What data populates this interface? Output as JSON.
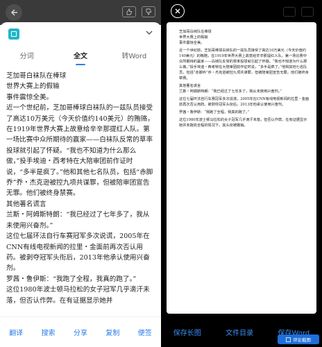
{
  "left": {
    "tabs": [
      {
        "label": "分词"
      },
      {
        "label": "全文"
      },
      {
        "label": "转Word"
      }
    ],
    "article": [
      "芝加哥白袜队在棒球",
      "世界大赛上的假输",
      "事件震惊全美。",
      "近一个世纪前，芝加哥棒球白袜队的一兹队员接受了高达10万美元（今天价值约140美元）的贿赂，在1919年世界大赛上故意给辛辛那提红人队。第一场比赛中众所期待的赢家——白袜队反常的草率投球就引起了怀疑。“我也不知道为什么那么做，”投手埃迪・西考特在大陪审团前作证时说，“多半是疯了。”他和其他七名队员，包括“赤脚乔”乔・杰克逊被控九项共谋罪，但被陪审团宣告无罪。他们被终身禁赛。",
      "其他著名谎言",
      "兰斯・阿姆斯特朗：“我已经过了七年多了，我从未使用兴奋剂。”",
      "这位七届环法自行车赛冠军多次说谎，2005年在CNN有线电视新闻的拉里・金面前再次否认用药。被剥夺冠军头衔后，2013年他承认使用兴奋剂。",
      "罗茜・鲁伊斯：“我跑了全程，我真的跑了。”",
      "这位1980年波士顿马拉松的女子冠军几乎滴汗未落，但否认作弊。在有证据显示她并"
    ],
    "bottom_bar": [
      {
        "label": "翻译"
      },
      {
        "label": "搜索"
      },
      {
        "label": "分享"
      },
      {
        "label": "复制"
      },
      {
        "label": "便签"
      }
    ]
  },
  "right": {
    "preview": [
      "芝加哥白袜队在棒球",
      "世界大赛上的假输",
      "事件震惊全美。",
      "近一个世纪前，芝加哥棒球白袜队的一兹队员接受了高达10万美元（今天价值约140美元）的贿赂，在1919年世界大赛上故意给辛辛那提红人队。第一场比赛中众所期待的赢家——白袜队反常的草率投球就引起了怀疑。“我也不知道为什么那么做，”投手埃迪・西考特在大陪审团前作证时说，“多半是疯了。”他和其他七名队员，包括“赤脚乔”乔・杰克逊被控九项共谋罪，但被陪审团宣告无罪。他们被终身禁赛。",
      "其他著名谎言",
      "兰斯・阿姆斯特朗：“我已经过了七年多了，我从未使用兴奋剂。”",
      "这位七届环法自行车赛冠军多次说谎，2005年在CNN有线电视新闻的拉里・金面前再次否认用药。被剥夺冠军头衔后，2013年他承认使用兴奋剂。",
      "罗茜・鲁伊斯：“我跑了全程，我真的跑了。”",
      "这位1980年波士顿马拉松的女子冠军几乎滴汗未落，但否认作弊。在有证据显示她并未跑完全程的情况下，其头衔被撤销。"
    ],
    "bottom_bar": [
      {
        "label": "保存长图"
      },
      {
        "label": "文件目录"
      },
      {
        "label": "保存Word"
      }
    ],
    "watermark": "评论截图"
  },
  "colors": {
    "accent": "#2b7de9",
    "app_icon": "#21b6c9"
  }
}
